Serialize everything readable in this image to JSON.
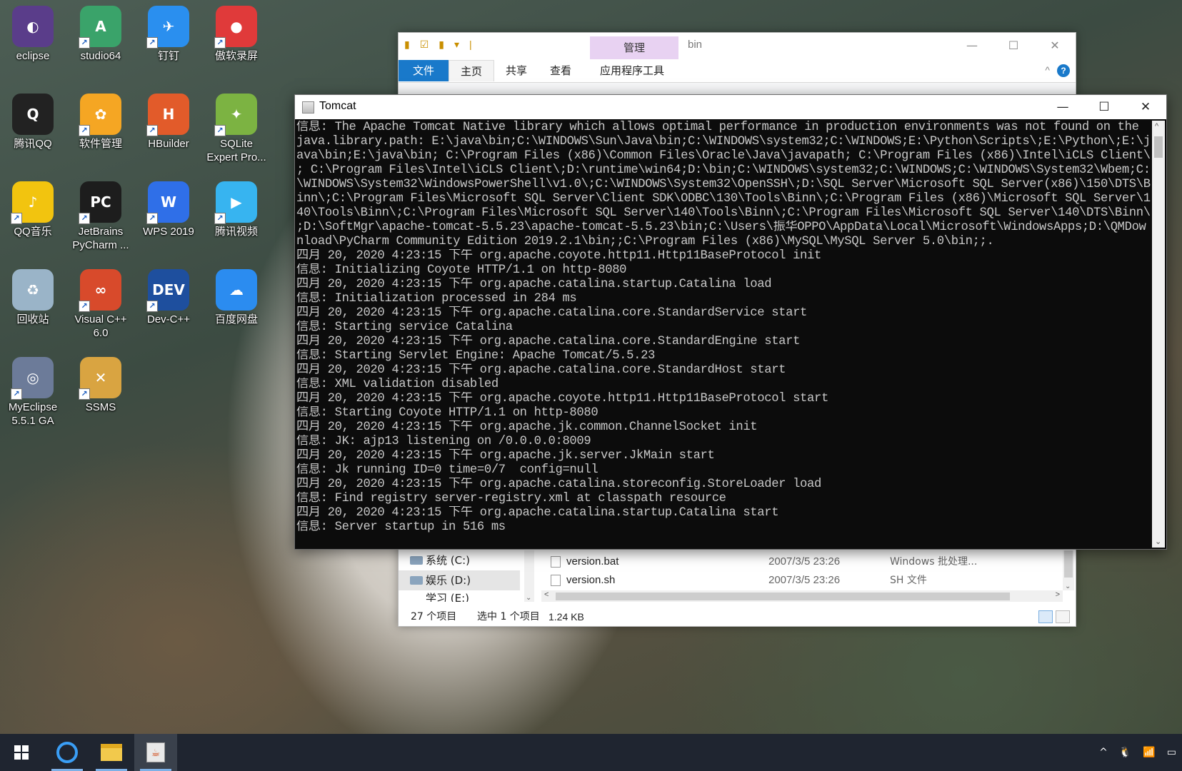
{
  "desktop_icons": [
    {
      "label": "eclipse",
      "icon": "eclipse-icon",
      "color": "#5a3d8a",
      "glyph": "◐"
    },
    {
      "label": "studio64",
      "icon": "android-studio-icon",
      "color": "#3aa36a",
      "glyph": "A"
    },
    {
      "label": "钉钉",
      "icon": "dingtalk-icon",
      "color": "#2a8fef",
      "glyph": "✈"
    },
    {
      "label": "傲软录屏",
      "icon": "screen-recorder-icon",
      "color": "#e03a3a",
      "glyph": "●"
    },
    {
      "label": "腾讯QQ",
      "icon": "qq-icon",
      "color": "#222222",
      "glyph": "Q"
    },
    {
      "label": "软件管理",
      "icon": "software-manager-icon",
      "color": "#f5a623",
      "glyph": "✿"
    },
    {
      "label": "HBuilder",
      "icon": "hbuilder-icon",
      "color": "#e25b2a",
      "glyph": "H"
    },
    {
      "label": "SQLite Expert Pro...",
      "icon": "sqlite-expert-icon",
      "color": "#7cb342",
      "glyph": "✦"
    },
    {
      "label": "QQ音乐",
      "icon": "qq-music-icon",
      "color": "#f2c40f",
      "glyph": "♪"
    },
    {
      "label": "JetBrains PyCharm ...",
      "icon": "pycharm-icon",
      "color": "#1d1d1d",
      "glyph": "PC"
    },
    {
      "label": "WPS 2019",
      "icon": "wps-icon",
      "color": "#2f6fe8",
      "glyph": "W"
    },
    {
      "label": "腾讯视频",
      "icon": "tencent-video-icon",
      "color": "#37b4f0",
      "glyph": "▶"
    },
    {
      "label": "回收站",
      "icon": "recycle-bin-icon",
      "color": "#9ab4c8",
      "glyph": "♻"
    },
    {
      "label": "Visual C++ 6.0",
      "icon": "visual-cpp-icon",
      "color": "#d84a2b",
      "glyph": "∞"
    },
    {
      "label": "Dev-C++",
      "icon": "devcpp-icon",
      "color": "#1e4f9e",
      "glyph": "DEV"
    },
    {
      "label": "百度网盘",
      "icon": "baidu-netdisk-icon",
      "color": "#2b8cf0",
      "glyph": "☁"
    },
    {
      "label": "MyEclipse 5.5.1 GA",
      "icon": "myeclipse-icon",
      "color": "#6c7b99",
      "glyph": "◎"
    },
    {
      "label": "SSMS",
      "icon": "ssms-icon",
      "color": "#d9a441",
      "glyph": "✕"
    }
  ],
  "explorer": {
    "quick_access": [
      "▮",
      "☑",
      "▮",
      "▾",
      "|"
    ],
    "manage_tab": "管理",
    "title": "bin",
    "window_buttons": [
      "—",
      "☐",
      "✕"
    ],
    "tabs": [
      "文件",
      "主页",
      "共享",
      "查看",
      "应用程序工具"
    ],
    "help": "?",
    "collapse": "^",
    "nav_items": [
      {
        "label": "系统 (C:)"
      },
      {
        "label": "娱乐 (D:)"
      },
      {
        "label": "学习 (E:)"
      }
    ],
    "nav_scroll_down": "⌄",
    "files": [
      {
        "name": "version.bat",
        "date": "2007/3/5 23:26",
        "type": "Windows 批处理..."
      },
      {
        "name": "version.sh",
        "date": "2007/3/5 23:26",
        "type": "SH 文件"
      }
    ],
    "scroll_left": "<",
    "scroll_right": ">",
    "scroll_down": "⌄",
    "status": {
      "count": "27 个项目",
      "selected": "选中 1 个项目",
      "size": "1.24 KB"
    }
  },
  "console": {
    "title": "Tomcat",
    "window_buttons": [
      "—",
      "☐",
      "✕"
    ],
    "scroll_up": "^",
    "scroll_down": "⌄",
    "lines": [
      "信息: The Apache Tomcat Native library which allows optimal performance in production environments was not found on the",
      "java.library.path: E:\\java\\bin;C:\\WINDOWS\\Sun\\Java\\bin;C:\\WINDOWS\\system32;C:\\WINDOWS;E:\\Python\\Scripts\\;E:\\Python\\;E:\\j",
      "ava\\bin;E:\\java\\bin; C:\\Program Files (x86)\\Common Files\\Oracle\\Java\\javapath; C:\\Program Files (x86)\\Intel\\iCLS Client\\",
      "; C:\\Program Files\\Intel\\iCLS Client\\;D:\\runtime\\win64;D:\\bin;C:\\WINDOWS\\system32;C:\\WINDOWS;C:\\WINDOWS\\System32\\Wbem;C:",
      "\\WINDOWS\\System32\\WindowsPowerShell\\v1.0\\;C:\\WINDOWS\\System32\\OpenSSH\\;D:\\SQL Server\\Microsoft SQL Server(x86)\\150\\DTS\\B",
      "inn\\;C:\\Program Files\\Microsoft SQL Server\\Client SDK\\ODBC\\130\\Tools\\Binn\\;C:\\Program Files (x86)\\Microsoft SQL Server\\1",
      "40\\Tools\\Binn\\;C:\\Program Files\\Microsoft SQL Server\\140\\Tools\\Binn\\;C:\\Program Files\\Microsoft SQL Server\\140\\DTS\\Binn\\",
      ";D:\\SoftMgr\\apache-tomcat-5.5.23\\apache-tomcat-5.5.23\\bin;C:\\Users\\振华OPPO\\AppData\\Local\\Microsoft\\WindowsApps;D:\\QMDow",
      "nload\\PyCharm Community Edition 2019.2.1\\bin;;C:\\Program Files (x86)\\MySQL\\MySQL Server 5.0\\bin;;.",
      "四月 20, 2020 4:23:15 下午 org.apache.coyote.http11.Http11BaseProtocol init",
      "信息: Initializing Coyote HTTP/1.1 on http-8080",
      "四月 20, 2020 4:23:15 下午 org.apache.catalina.startup.Catalina load",
      "信息: Initialization processed in 284 ms",
      "四月 20, 2020 4:23:15 下午 org.apache.catalina.core.StandardService start",
      "信息: Starting service Catalina",
      "四月 20, 2020 4:23:15 下午 org.apache.catalina.core.StandardEngine start",
      "信息: Starting Servlet Engine: Apache Tomcat/5.5.23",
      "四月 20, 2020 4:23:15 下午 org.apache.catalina.core.StandardHost start",
      "信息: XML validation disabled",
      "四月 20, 2020 4:23:15 下午 org.apache.coyote.http11.Http11BaseProtocol start",
      "信息: Starting Coyote HTTP/1.1 on http-8080",
      "四月 20, 2020 4:23:15 下午 org.apache.jk.common.ChannelSocket init",
      "信息: JK: ajp13 listening on /0.0.0.0:8009",
      "四月 20, 2020 4:23:15 下午 org.apache.jk.server.JkMain start",
      "信息: Jk running ID=0 time=0/7  config=null",
      "四月 20, 2020 4:23:15 下午 org.apache.catalina.storeconfig.StoreLoader load",
      "信息: Find registry server-registry.xml at classpath resource",
      "四月 20, 2020 4:23:15 下午 org.apache.catalina.startup.Catalina start",
      "信息: Server startup in 516 ms"
    ]
  },
  "taskbar": {
    "apps": [
      {
        "name": "qq-browser",
        "active": false
      },
      {
        "name": "file-explorer",
        "active": false
      },
      {
        "name": "java-console",
        "active": true
      }
    ],
    "java_glyph": "☕",
    "tray": [
      "^",
      "🐧",
      "📶",
      "▭"
    ]
  }
}
